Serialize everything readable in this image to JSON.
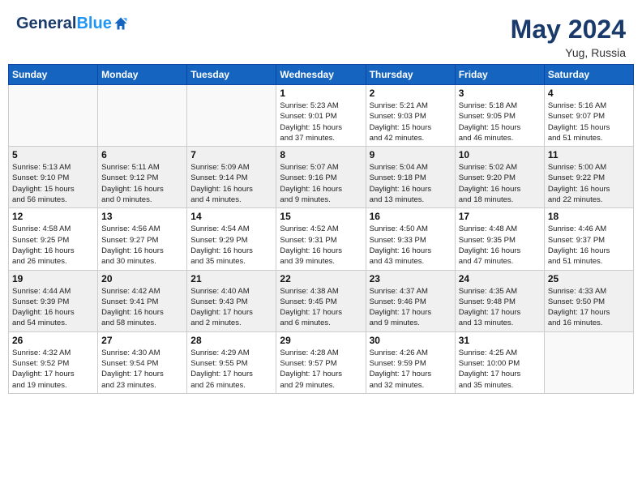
{
  "header": {
    "logo_line1": "General",
    "logo_line2": "Blue",
    "month_year": "May 2024",
    "location": "Yug, Russia"
  },
  "days_of_week": [
    "Sunday",
    "Monday",
    "Tuesday",
    "Wednesday",
    "Thursday",
    "Friday",
    "Saturday"
  ],
  "weeks": [
    [
      {
        "day": "",
        "detail": ""
      },
      {
        "day": "",
        "detail": ""
      },
      {
        "day": "",
        "detail": ""
      },
      {
        "day": "1",
        "detail": "Sunrise: 5:23 AM\nSunset: 9:01 PM\nDaylight: 15 hours\nand 37 minutes."
      },
      {
        "day": "2",
        "detail": "Sunrise: 5:21 AM\nSunset: 9:03 PM\nDaylight: 15 hours\nand 42 minutes."
      },
      {
        "day": "3",
        "detail": "Sunrise: 5:18 AM\nSunset: 9:05 PM\nDaylight: 15 hours\nand 46 minutes."
      },
      {
        "day": "4",
        "detail": "Sunrise: 5:16 AM\nSunset: 9:07 PM\nDaylight: 15 hours\nand 51 minutes."
      }
    ],
    [
      {
        "day": "5",
        "detail": "Sunrise: 5:13 AM\nSunset: 9:10 PM\nDaylight: 15 hours\nand 56 minutes."
      },
      {
        "day": "6",
        "detail": "Sunrise: 5:11 AM\nSunset: 9:12 PM\nDaylight: 16 hours\nand 0 minutes."
      },
      {
        "day": "7",
        "detail": "Sunrise: 5:09 AM\nSunset: 9:14 PM\nDaylight: 16 hours\nand 4 minutes."
      },
      {
        "day": "8",
        "detail": "Sunrise: 5:07 AM\nSunset: 9:16 PM\nDaylight: 16 hours\nand 9 minutes."
      },
      {
        "day": "9",
        "detail": "Sunrise: 5:04 AM\nSunset: 9:18 PM\nDaylight: 16 hours\nand 13 minutes."
      },
      {
        "day": "10",
        "detail": "Sunrise: 5:02 AM\nSunset: 9:20 PM\nDaylight: 16 hours\nand 18 minutes."
      },
      {
        "day": "11",
        "detail": "Sunrise: 5:00 AM\nSunset: 9:22 PM\nDaylight: 16 hours\nand 22 minutes."
      }
    ],
    [
      {
        "day": "12",
        "detail": "Sunrise: 4:58 AM\nSunset: 9:25 PM\nDaylight: 16 hours\nand 26 minutes."
      },
      {
        "day": "13",
        "detail": "Sunrise: 4:56 AM\nSunset: 9:27 PM\nDaylight: 16 hours\nand 30 minutes."
      },
      {
        "day": "14",
        "detail": "Sunrise: 4:54 AM\nSunset: 9:29 PM\nDaylight: 16 hours\nand 35 minutes."
      },
      {
        "day": "15",
        "detail": "Sunrise: 4:52 AM\nSunset: 9:31 PM\nDaylight: 16 hours\nand 39 minutes."
      },
      {
        "day": "16",
        "detail": "Sunrise: 4:50 AM\nSunset: 9:33 PM\nDaylight: 16 hours\nand 43 minutes."
      },
      {
        "day": "17",
        "detail": "Sunrise: 4:48 AM\nSunset: 9:35 PM\nDaylight: 16 hours\nand 47 minutes."
      },
      {
        "day": "18",
        "detail": "Sunrise: 4:46 AM\nSunset: 9:37 PM\nDaylight: 16 hours\nand 51 minutes."
      }
    ],
    [
      {
        "day": "19",
        "detail": "Sunrise: 4:44 AM\nSunset: 9:39 PM\nDaylight: 16 hours\nand 54 minutes."
      },
      {
        "day": "20",
        "detail": "Sunrise: 4:42 AM\nSunset: 9:41 PM\nDaylight: 16 hours\nand 58 minutes."
      },
      {
        "day": "21",
        "detail": "Sunrise: 4:40 AM\nSunset: 9:43 PM\nDaylight: 17 hours\nand 2 minutes."
      },
      {
        "day": "22",
        "detail": "Sunrise: 4:38 AM\nSunset: 9:45 PM\nDaylight: 17 hours\nand 6 minutes."
      },
      {
        "day": "23",
        "detail": "Sunrise: 4:37 AM\nSunset: 9:46 PM\nDaylight: 17 hours\nand 9 minutes."
      },
      {
        "day": "24",
        "detail": "Sunrise: 4:35 AM\nSunset: 9:48 PM\nDaylight: 17 hours\nand 13 minutes."
      },
      {
        "day": "25",
        "detail": "Sunrise: 4:33 AM\nSunset: 9:50 PM\nDaylight: 17 hours\nand 16 minutes."
      }
    ],
    [
      {
        "day": "26",
        "detail": "Sunrise: 4:32 AM\nSunset: 9:52 PM\nDaylight: 17 hours\nand 19 minutes."
      },
      {
        "day": "27",
        "detail": "Sunrise: 4:30 AM\nSunset: 9:54 PM\nDaylight: 17 hours\nand 23 minutes."
      },
      {
        "day": "28",
        "detail": "Sunrise: 4:29 AM\nSunset: 9:55 PM\nDaylight: 17 hours\nand 26 minutes."
      },
      {
        "day": "29",
        "detail": "Sunrise: 4:28 AM\nSunset: 9:57 PM\nDaylight: 17 hours\nand 29 minutes."
      },
      {
        "day": "30",
        "detail": "Sunrise: 4:26 AM\nSunset: 9:59 PM\nDaylight: 17 hours\nand 32 minutes."
      },
      {
        "day": "31",
        "detail": "Sunrise: 4:25 AM\nSunset: 10:00 PM\nDaylight: 17 hours\nand 35 minutes."
      },
      {
        "day": "",
        "detail": ""
      }
    ]
  ]
}
